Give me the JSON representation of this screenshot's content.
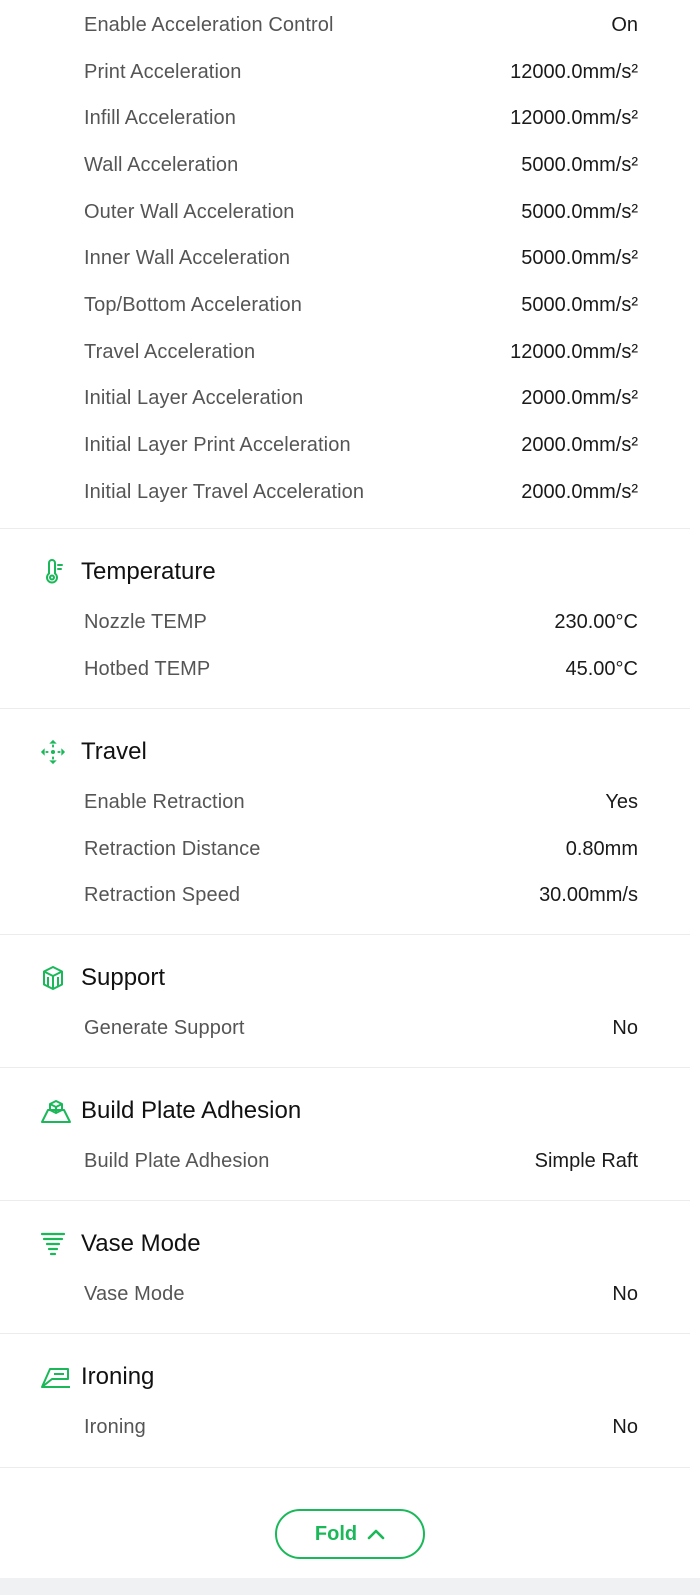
{
  "accent_color": "#1bb85a",
  "acceleration_rows": [
    {
      "label": "Enable Acceleration Control",
      "value": "On"
    },
    {
      "label": "Print Acceleration",
      "value": "12000.0mm/s²"
    },
    {
      "label": "Infill Acceleration",
      "value": "12000.0mm/s²"
    },
    {
      "label": "Wall Acceleration",
      "value": "5000.0mm/s²"
    },
    {
      "label": "Outer Wall Acceleration",
      "value": "5000.0mm/s²"
    },
    {
      "label": "Inner Wall Acceleration",
      "value": "5000.0mm/s²"
    },
    {
      "label": "Top/Bottom Acceleration",
      "value": "5000.0mm/s²"
    },
    {
      "label": "Travel Acceleration",
      "value": "12000.0mm/s²"
    },
    {
      "label": "Initial Layer Acceleration",
      "value": "2000.0mm/s²"
    },
    {
      "label": "Initial Layer Print Acceleration",
      "value": "2000.0mm/s²"
    },
    {
      "label": "Initial Layer Travel Acceleration",
      "value": "2000.0mm/s²"
    }
  ],
  "sections": [
    {
      "title": "Temperature",
      "icon": "thermometer-icon",
      "rows": [
        {
          "label": "Nozzle TEMP",
          "value": "230.00°C"
        },
        {
          "label": "Hotbed TEMP",
          "value": "45.00°C"
        }
      ]
    },
    {
      "title": "Travel",
      "icon": "move-arrows-icon",
      "rows": [
        {
          "label": "Enable Retraction",
          "value": "Yes"
        },
        {
          "label": "Retraction Distance",
          "value": "0.80mm"
        },
        {
          "label": "Retraction Speed",
          "value": "30.00mm/s"
        }
      ]
    },
    {
      "title": "Support",
      "icon": "support-cube-icon",
      "rows": [
        {
          "label": "Generate Support",
          "value": "No"
        }
      ]
    },
    {
      "title": "Build Plate Adhesion",
      "icon": "build-plate-icon",
      "rows": [
        {
          "label": "Build Plate Adhesion",
          "value": "Simple Raft"
        }
      ]
    },
    {
      "title": "Vase Mode",
      "icon": "vase-spiral-icon",
      "rows": [
        {
          "label": "Vase Mode",
          "value": "No"
        }
      ]
    },
    {
      "title": "Ironing",
      "icon": "ironing-icon",
      "rows": [
        {
          "label": "Ironing",
          "value": "No"
        }
      ]
    }
  ],
  "fold_button": {
    "label": "Fold",
    "icon": "chevron-up-icon"
  }
}
